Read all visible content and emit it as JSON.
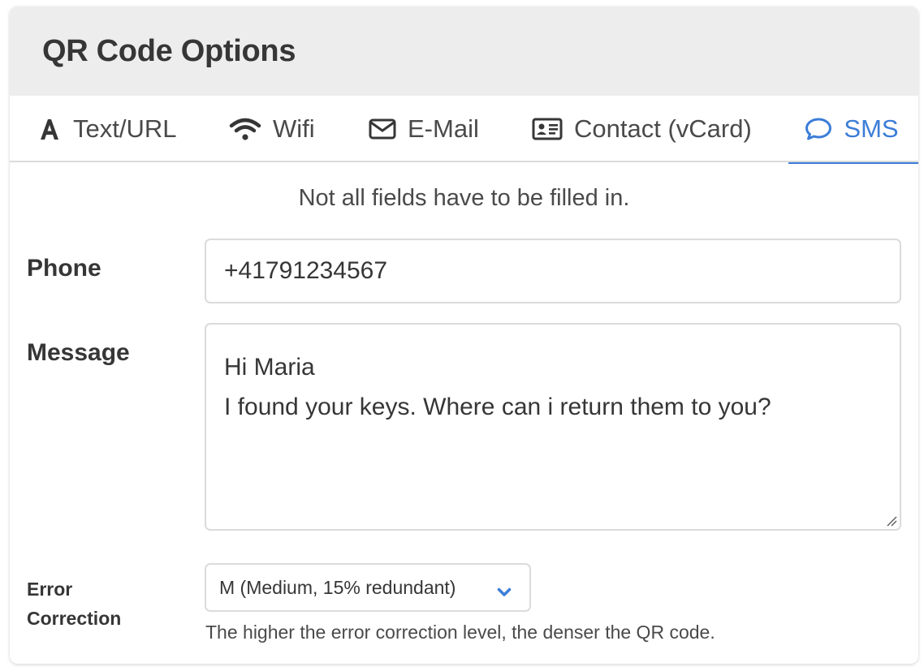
{
  "header": {
    "title": "QR Code Options"
  },
  "tabs": [
    {
      "label": "Text/URL",
      "icon": "font-letter-a-icon"
    },
    {
      "label": "Wifi",
      "icon": "wifi-icon"
    },
    {
      "label": "E-Mail",
      "icon": "envelope-icon"
    },
    {
      "label": "Contact (vCard)",
      "icon": "id-card-icon"
    },
    {
      "label": "SMS",
      "icon": "comment-icon",
      "active": true
    }
  ],
  "form": {
    "notice": "Not all fields have to be filled in.",
    "phone": {
      "label": "Phone",
      "value": "+41791234567"
    },
    "message": {
      "label": "Message",
      "value": "Hi Maria\nI found your keys. Where can i return them to you?"
    },
    "error_correction": {
      "label": "Error Correction",
      "selected": "M (Medium, 15% redundant)",
      "help": "The higher the error correction level, the denser the QR code."
    }
  },
  "colors": {
    "accent": "#3b7dd8",
    "header_bg": "#ededed",
    "border": "#dbdbdb",
    "text": "#363636"
  }
}
